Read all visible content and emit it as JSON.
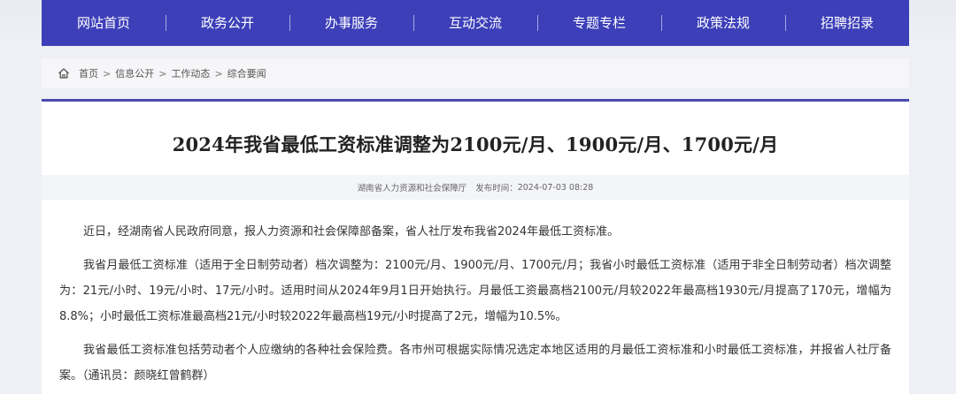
{
  "nav": {
    "items": [
      "网站首页",
      "政务公开",
      "办事服务",
      "互动交流",
      "专题专栏",
      "政策法规",
      "招聘招录"
    ]
  },
  "breadcrumb": {
    "items": [
      "首页",
      "信息公开",
      "工作动态",
      "综合要闻"
    ],
    "separator": ">"
  },
  "article": {
    "title": "2024年我省最低工资标准调整为2100元/月、1900元/月、1700元/月",
    "source": "湖南省人力资源和社会保障厅",
    "publish_label": "发布时间：",
    "publish_time": "2024-07-03 08:28",
    "paragraphs": [
      "近日，经湖南省人民政府同意，报人力资源和社会保障部备案，省人社厅发布我省2024年最低工资标准。",
      "我省月最低工资标准（适用于全日制劳动者）档次调整为：2100元/月、1900元/月、1700元/月；我省小时最低工资标准（适用于非全日制劳动者）档次调整为：21元/小时、19元/小时、17元/小时。适用时间从2024年9月1日开始执行。月最低工资最高档2100元/月较2022年最高档1930元/月提高了170元，增幅为8.8%；小时最低工资标准最高档21元/小时较2022年最高档19元/小时提高了2元，增幅为10.5%。",
      "我省最低工资标准包括劳动者个人应缴纳的各种社会保险费。各市州可根据实际情况选定本地区适用的月最低工资标准和小时最低工资标准，并报省人社厅备案。（通讯员：颜晓红曾鹤群）"
    ]
  },
  "colors": {
    "nav_bg": "#3c3fb8",
    "accent_border": "#4a4ab0",
    "page_bg": "#eef0f5"
  },
  "icons": {
    "breadcrumb_home": "home-icon"
  }
}
